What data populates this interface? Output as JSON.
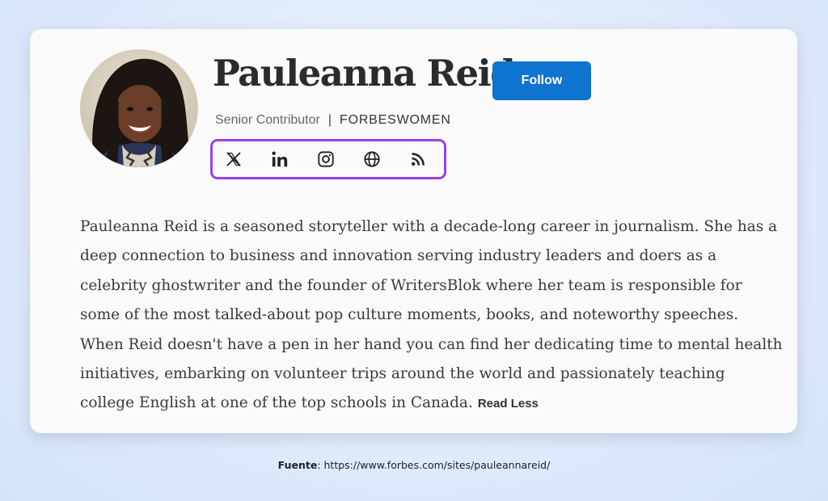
{
  "profile": {
    "name": "Pauleanna Reid",
    "follow_label": "Follow",
    "role": "Senior Contributor",
    "separator": "|",
    "publication": "FORBESWOMEN"
  },
  "social": {
    "icons": [
      "x-icon",
      "linkedin-icon",
      "instagram-icon",
      "globe-icon",
      "rss-icon"
    ],
    "highlight_color": "#9b3ff0"
  },
  "bio": {
    "text": "Pauleanna Reid is a seasoned storyteller with a decade-long career in journalism. She has a deep connection to business and innovation serving industry leaders and doers as a celebrity ghostwriter and the founder of WritersBlok where her team is responsible for some of the most talked-about pop culture moments, books, and noteworthy speeches. When Reid doesn't have a pen in her hand you can find her dedicating time to mental health initiatives, embarking on volunteer trips around the world and passionately teaching college English at one of the top schools in Canada.",
    "read_less_label": "Read Less"
  },
  "source": {
    "label": "Fuente",
    "url": ": https://www.forbes.com/sites/pauleannareid/"
  },
  "colors": {
    "follow_button": "#0f74cf",
    "card": "#fafafa"
  }
}
